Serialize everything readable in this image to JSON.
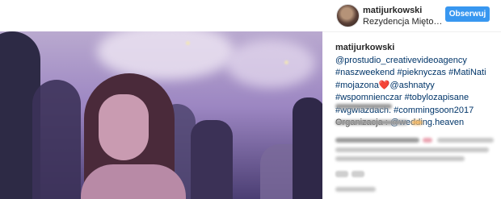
{
  "post": {
    "username": "matijurkowski",
    "location": "Rezydencja Mięto…",
    "follow_label": "Obserwuj",
    "avatar_icon": "profile-avatar",
    "caption": {
      "owner": "matijurkowski",
      "segments": [
        "@prostudio_creativevideoagency",
        "#naszweekend",
        "#pieknyczas",
        "#MatiNati",
        "#mojazona",
        "@ashnatyy",
        "#wspomnienczar",
        "#tobylozapisane",
        "#wgwiazdach.",
        "#commingsoon2017"
      ],
      "organization_label": "Organizacja :",
      "organization_link": "@wedding.heaven"
    }
  },
  "colors": {
    "follow_button": "#3897f0",
    "link": "#003569",
    "heart": "#ed4956"
  }
}
